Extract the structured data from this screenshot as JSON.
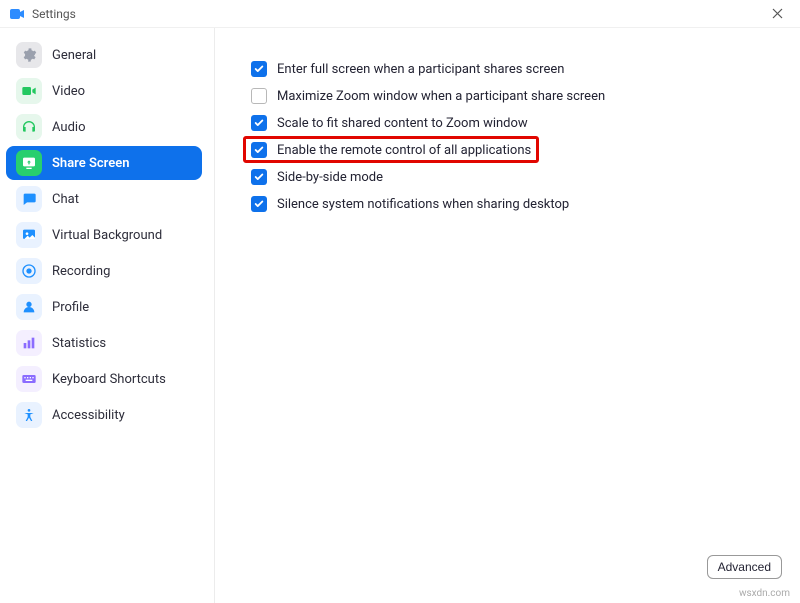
{
  "window": {
    "title": "Settings"
  },
  "sidebar": {
    "items": [
      {
        "key": "general",
        "label": "General",
        "icon_bg": "#e7e7ea",
        "icon_fg": "#9aa0ad"
      },
      {
        "key": "video",
        "label": "Video",
        "icon_bg": "#e6f7ec",
        "icon_fg": "#23c860"
      },
      {
        "key": "audio",
        "label": "Audio",
        "icon_bg": "#e6f7ec",
        "icon_fg": "#23c860"
      },
      {
        "key": "share-screen",
        "label": "Share Screen",
        "icon_bg": "#28cf6e",
        "icon_fg": "#ffffff",
        "active": true
      },
      {
        "key": "chat",
        "label": "Chat",
        "icon_bg": "#e9f2ff",
        "icon_fg": "#1e90ff"
      },
      {
        "key": "virtual-background",
        "label": "Virtual Background",
        "icon_bg": "#e9f2ff",
        "icon_fg": "#1e90ff"
      },
      {
        "key": "recording",
        "label": "Recording",
        "icon_bg": "#e9f2ff",
        "icon_fg": "#1e90ff"
      },
      {
        "key": "profile",
        "label": "Profile",
        "icon_bg": "#e9f2ff",
        "icon_fg": "#1e90ff"
      },
      {
        "key": "statistics",
        "label": "Statistics",
        "icon_bg": "#f4efff",
        "icon_fg": "#8b6cff"
      },
      {
        "key": "keyboard-shortcuts",
        "label": "Keyboard Shortcuts",
        "icon_bg": "#f4efff",
        "icon_fg": "#8b6cff"
      },
      {
        "key": "accessibility",
        "label": "Accessibility",
        "icon_bg": "#e9f2ff",
        "icon_fg": "#1e90ff"
      }
    ]
  },
  "options": [
    {
      "key": "full-screen",
      "label": "Enter full screen when a participant shares screen",
      "checked": true
    },
    {
      "key": "maximize",
      "label": "Maximize Zoom window when a participant share screen",
      "checked": false
    },
    {
      "key": "scale-fit",
      "label": "Scale to fit shared content to Zoom window",
      "checked": true
    },
    {
      "key": "remote-control",
      "label": "Enable the remote control of all applications",
      "checked": true,
      "highlighted": true
    },
    {
      "key": "side-by-side",
      "label": "Side-by-side mode",
      "checked": true
    },
    {
      "key": "silence-notifications",
      "label": "Silence system notifications when sharing desktop",
      "checked": true
    }
  ],
  "buttons": {
    "advanced": "Advanced"
  },
  "watermark": "wsxdn.com"
}
